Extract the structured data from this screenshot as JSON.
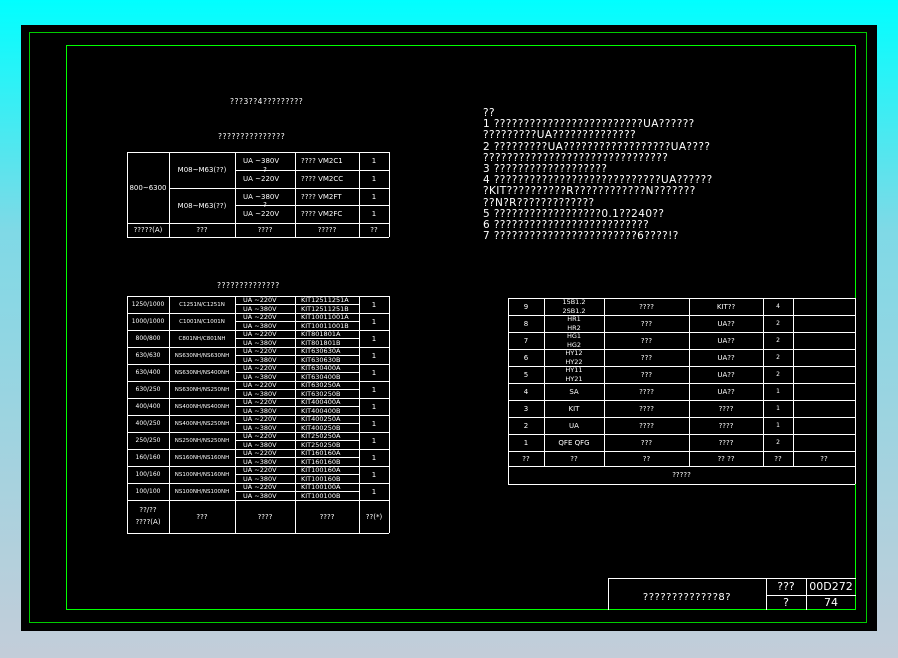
{
  "top_table": {
    "title_1": "???3??4?????????",
    "title_2": "???????????????",
    "range": "800~6300",
    "rows": [
      {
        "breaker": "M08~M63(??)",
        "voltages": [
          "UA ~380V",
          "UA ~220V"
        ],
        "ctrl": [
          "???? VM2C1",
          "???? VM2CC"
        ],
        "qty": [
          "1",
          "1"
        ],
        "mark": "?"
      },
      {
        "breaker": "M08~M63(??)",
        "voltages": [
          "UA ~380V",
          "UA ~220V"
        ],
        "ctrl": [
          "???? VM2FT",
          "???? VM2FC"
        ],
        "qty": [
          "1",
          "1"
        ],
        "mark": "?"
      }
    ],
    "footer": [
      "?????(A)",
      "???",
      "????",
      "?????",
      "??"
    ]
  },
  "notes": [
    "??",
    "1 ?????????????????????????UA??????",
    "  ?????????UA??????????????",
    "2 ?????????UA??????????????????UA????",
    "  ???????????????????????????????",
    "3 ???????????????????",
    "4 ????????????????????????????UA??????",
    "  ?KIT??????????R????????????N???????",
    "  ??N?R?????????????",
    "5 ??????????????????0.1??240??",
    "6 ??????????????????????????",
    "7 ????????????????????????6????!?"
  ],
  "mid_table": {
    "title": "??????????????",
    "rows": [
      {
        "rating": "1250/1000",
        "breaker": "C1251N/C1251N",
        "kits": [
          "KIT12511251A",
          "KIT12511251B"
        ],
        "qty": "1"
      },
      {
        "rating": "1000/1000",
        "breaker": "C1001N/C1001N",
        "kits": [
          "KIT10011001A",
          "KIT10011001B"
        ],
        "qty": "1"
      },
      {
        "rating": "800/800",
        "breaker": "C801NH/C801NH",
        "kits": [
          "KIT801801A",
          "KIT801801B"
        ],
        "qty": "1"
      },
      {
        "rating": "630/630",
        "breaker": "NS630NH/NS630NH",
        "kits": [
          "KIT630630A",
          "KIT630630B"
        ],
        "qty": "1"
      },
      {
        "rating": "630/400",
        "breaker": "NS630NH/NS400NH",
        "kits": [
          "KIT630400A",
          "KIT630400B"
        ],
        "qty": "1"
      },
      {
        "rating": "630/250",
        "breaker": "NS630NH/NS250NH",
        "kits": [
          "KIT630250A",
          "KIT630250B"
        ],
        "qty": "1"
      },
      {
        "rating": "400/400",
        "breaker": "NS400NH/NS400NH",
        "kits": [
          "KIT400400A",
          "KIT400400B"
        ],
        "qty": "1"
      },
      {
        "rating": "400/250",
        "breaker": "NS400NH/NS250NH",
        "kits": [
          "KIT400250A",
          "KIT400250B"
        ],
        "qty": "1"
      },
      {
        "rating": "250/250",
        "breaker": "NS250NH/NS250NH",
        "kits": [
          "KIT250250A",
          "KIT250250B"
        ],
        "qty": "1"
      },
      {
        "rating": "160/160",
        "breaker": "NS160NH/NS160NH",
        "kits": [
          "KIT160160A",
          "KIT160160B"
        ],
        "qty": "1"
      },
      {
        "rating": "100/160",
        "breaker": "NS100NH/NS160NH",
        "kits": [
          "KIT100160A",
          "KIT100160B"
        ],
        "qty": "1"
      },
      {
        "rating": "100/100",
        "breaker": "NS100NH/NS100NH",
        "kits": [
          "KIT100100A",
          "KIT100100B"
        ],
        "qty": "1"
      }
    ],
    "voltages": [
      "UA ~220V",
      "UA ~380V"
    ],
    "footer": [
      "??/??",
      "????(A)",
      "???",
      "????",
      "????",
      "??(*)"
    ]
  },
  "parts_table": {
    "rows": [
      {
        "no": "9",
        "code": [
          "15B1.2",
          "2SB1.2"
        ],
        "name": "????",
        "model": "KIT??",
        "qty": "4"
      },
      {
        "no": "8",
        "code": [
          "HR1",
          "HR2"
        ],
        "name": "???",
        "model": "UA??",
        "qty": "2"
      },
      {
        "no": "7",
        "code": [
          "HG1",
          "HG2"
        ],
        "name": "???",
        "model": "UA??",
        "qty": "2"
      },
      {
        "no": "6",
        "code": [
          "HY12",
          "HY22"
        ],
        "name": "???",
        "model": "UA??",
        "qty": "2"
      },
      {
        "no": "5",
        "code": [
          "HY11",
          "HY21"
        ],
        "name": "???",
        "model": "UA??",
        "qty": "2"
      },
      {
        "no": "4",
        "code": [
          "SA"
        ],
        "name": "????",
        "model": "UA??",
        "qty": "1"
      },
      {
        "no": "3",
        "code": [
          "KIT"
        ],
        "name": "????",
        "model": "????",
        "qty": "1"
      },
      {
        "no": "2",
        "code": [
          "UA"
        ],
        "name": "????",
        "model": "????",
        "qty": "1"
      },
      {
        "no": "1",
        "code": [
          "QFE  QFG"
        ],
        "name": "???",
        "model": "????",
        "qty": "2"
      }
    ],
    "header": [
      "??",
      "??",
      "??",
      "??  ??",
      "??",
      "??"
    ],
    "caption": "?????"
  },
  "title_block": {
    "name": "?????????????8?",
    "label_1": "???",
    "drawing_no": "00D272",
    "label_2": "?",
    "page": "74"
  }
}
